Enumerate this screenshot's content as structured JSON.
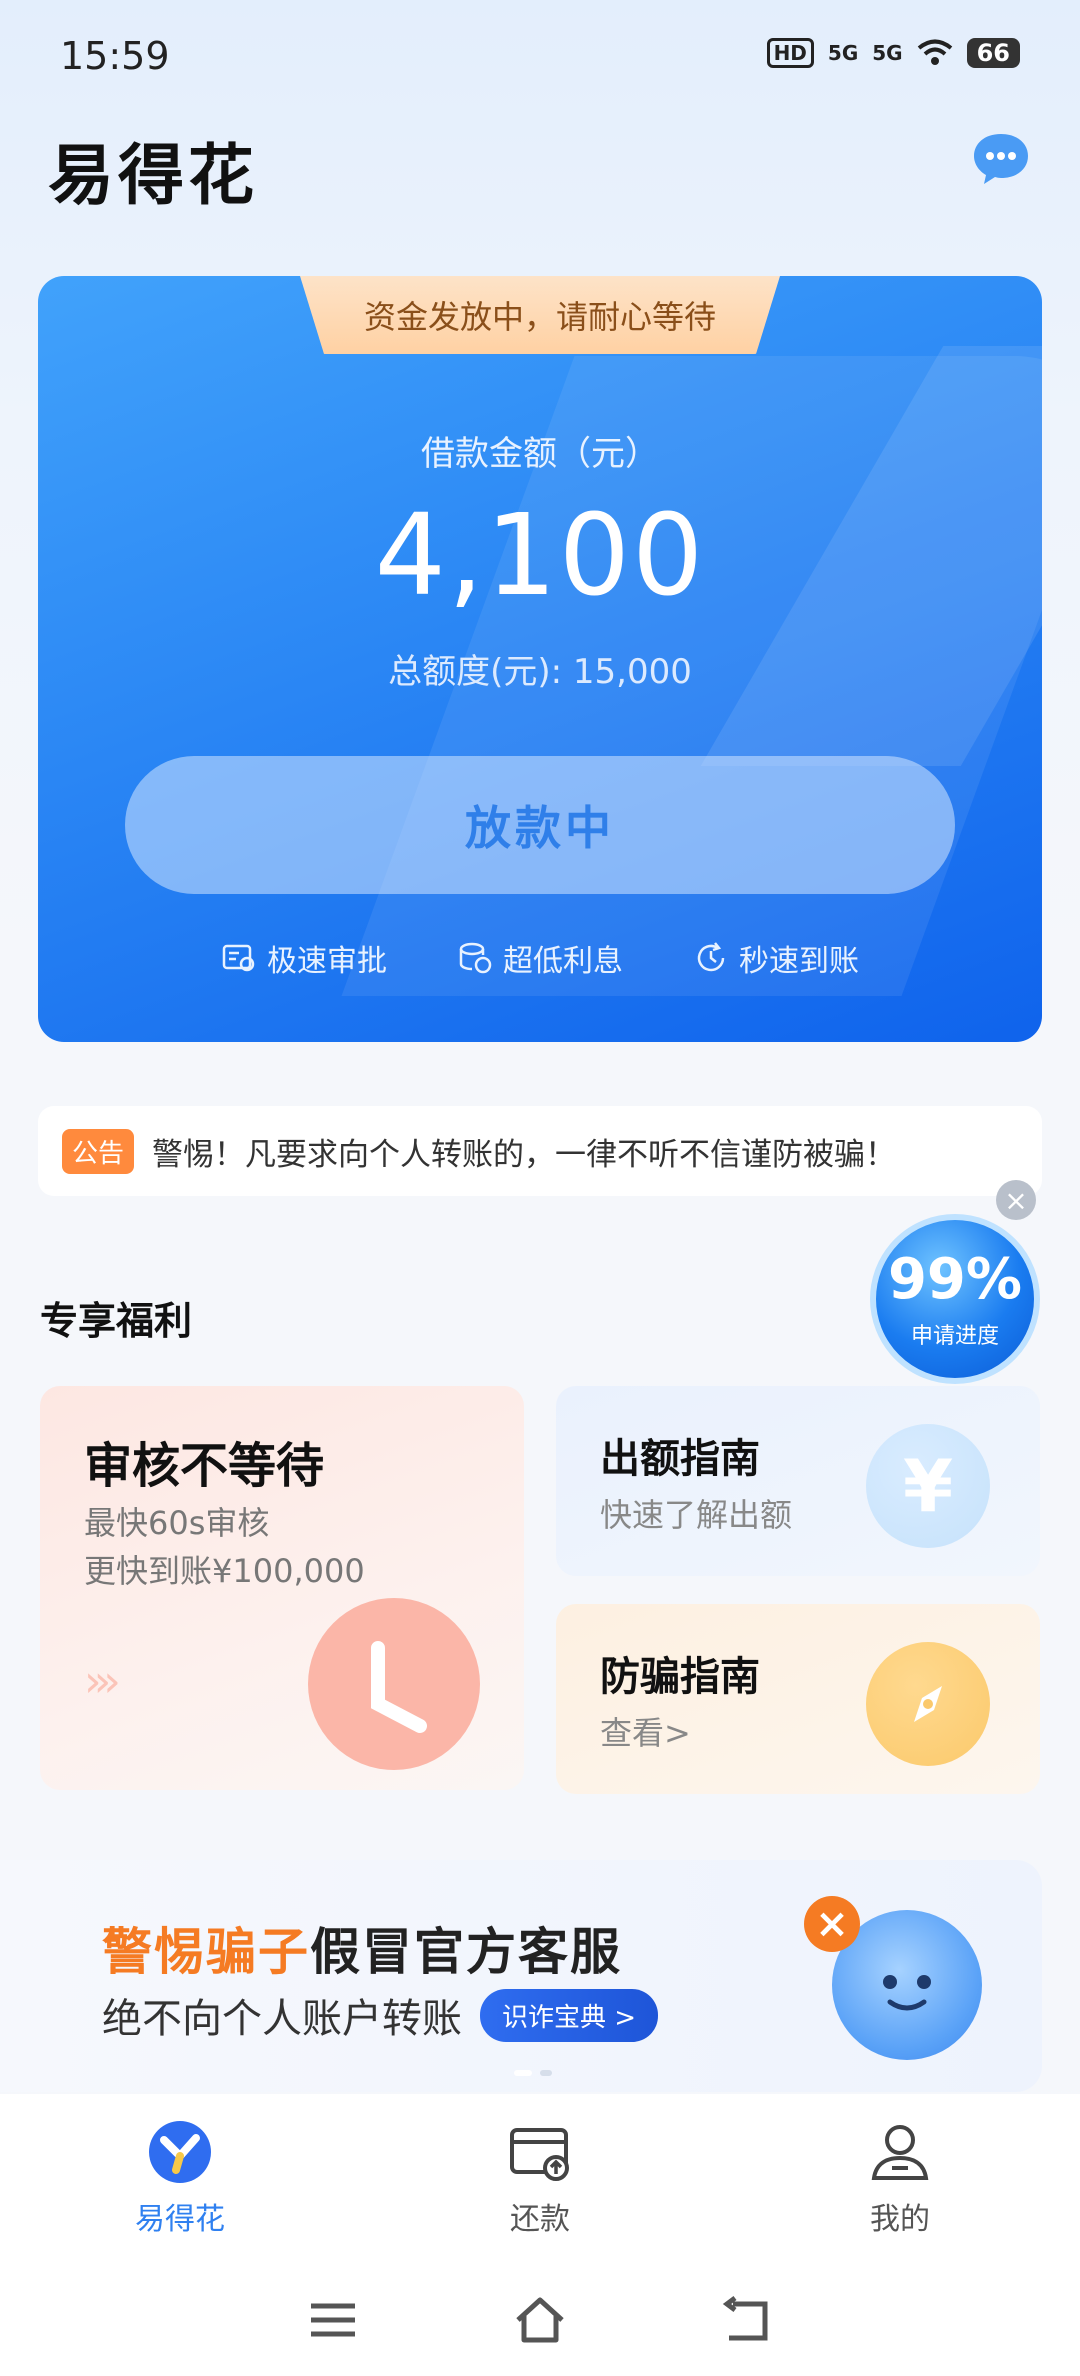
{
  "status_bar": {
    "time": "15:59",
    "hd": "HD",
    "signal1": "5G",
    "signal2": "5G",
    "battery": "66"
  },
  "header": {
    "title": "易得花",
    "chat_icon": "chat-bubble-icon"
  },
  "hero": {
    "banner": "资金发放中，请耐心等待",
    "loan_label": "借款金额（元）",
    "loan_amount": "4,100",
    "total_limit": "总额度(元): 15,000",
    "status_button": "放款中",
    "features": [
      {
        "label": "极速审批",
        "icon": "approval-icon"
      },
      {
        "label": "超低利息",
        "icon": "coins-icon"
      },
      {
        "label": "秒速到账",
        "icon": "clock-arrow-icon"
      }
    ],
    "colors": {
      "card_start": "#41a2fb",
      "card_end": "#0f63ec",
      "banner": "#ffd1a3"
    }
  },
  "notice": {
    "tag": "公告",
    "text": "警惕！凡要求向个人转账的，一律不听不信谨防被骗！"
  },
  "progress_badge": {
    "percent": "99%",
    "label": "申请进度",
    "close": "×"
  },
  "benefits": {
    "title": "专享福利",
    "big_card": {
      "title": "审核不等待",
      "line1": "最快60s审核",
      "line2": "更快到账¥100,000",
      "arrows": "›››"
    },
    "card_quota": {
      "title": "出额指南",
      "subtitle": "快速了解出额",
      "icon_glyph": "¥"
    },
    "card_fraud": {
      "title": "防骗指南",
      "subtitle": "查看>"
    }
  },
  "promo": {
    "highlight": "警惕骗子",
    "rest": "假冒官方客服",
    "line2": "绝不向个人账户转账",
    "pill": "识诈宝典 >",
    "badge": "×"
  },
  "bottom_nav": {
    "items": [
      {
        "label": "易得花",
        "active": true
      },
      {
        "label": "还款",
        "active": false
      },
      {
        "label": "我的",
        "active": false
      }
    ]
  }
}
